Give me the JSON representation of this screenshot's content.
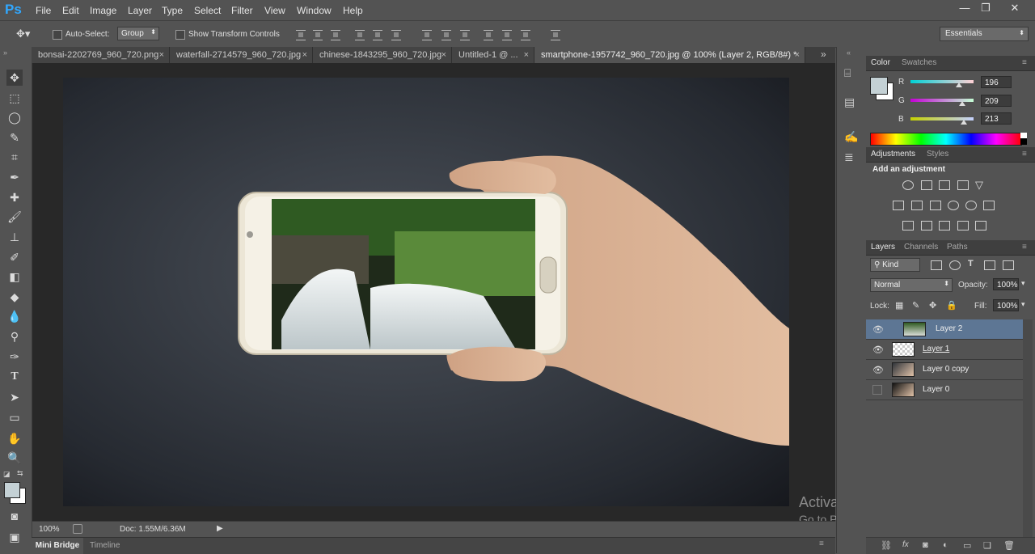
{
  "app": {
    "logo": "Ps"
  },
  "menu": [
    "File",
    "Edit",
    "Image",
    "Layer",
    "Type",
    "Select",
    "Filter",
    "View",
    "Window",
    "Help"
  ],
  "window_controls": {
    "minimize": "—",
    "restore": "❐",
    "close": "✕"
  },
  "options_bar": {
    "auto_select_label": "Auto-Select:",
    "auto_select_value": "Group",
    "show_transform_label": "Show Transform Controls",
    "workspace": "Essentials"
  },
  "tabs": [
    {
      "label": "bonsai-2202769_960_720.png"
    },
    {
      "label": "waterfall-2714579_960_720.jpg"
    },
    {
      "label": "chinese-1843295_960_720.jpg"
    },
    {
      "label": "Untitled-1 @ ..."
    },
    {
      "label": "smartphone-1957742_960_720.jpg @ 100% (Layer 2, RGB/8#) *"
    }
  ],
  "tab_close": "×",
  "status": {
    "zoom": "100%",
    "doc": "Doc: 1.55M/6.36M"
  },
  "bottom_tabs": [
    "Mini Bridge",
    "Timeline"
  ],
  "color_panel": {
    "tabs": [
      "Color",
      "Swatches"
    ],
    "r_label": "R",
    "g_label": "G",
    "b_label": "B",
    "r": "196",
    "g": "209",
    "b": "213",
    "r_fraction": 0.77,
    "g_fraction": 0.82,
    "b_fraction": 0.84,
    "swatch_color": "#c4d1d5"
  },
  "adjustments_panel": {
    "tabs": [
      "Adjustments",
      "Styles"
    ],
    "title": "Add an adjustment"
  },
  "layers_panel": {
    "tabs": [
      "Layers",
      "Channels",
      "Paths"
    ],
    "filter_kind": "Kind",
    "blend_mode": "Normal",
    "opacity_label": "Opacity:",
    "opacity": "100%",
    "lock_label": "Lock:",
    "fill_label": "Fill:",
    "fill": "100%",
    "layers": [
      {
        "name": "Layer 2",
        "visible": true,
        "selected": true
      },
      {
        "name": "Layer 1",
        "visible": true,
        "selected": false
      },
      {
        "name": "Layer 0 copy",
        "visible": true,
        "selected": false
      },
      {
        "name": "Layer 0",
        "visible": false,
        "selected": false
      }
    ],
    "footer_icons": [
      "link-icon",
      "fx-icon",
      "mask-icon",
      "adjustment-icon",
      "group-icon",
      "new-layer-icon",
      "trash-icon"
    ]
  },
  "watermark": {
    "line1": "Activate Windows",
    "line2": "Go to PC settings to activate Windows."
  }
}
